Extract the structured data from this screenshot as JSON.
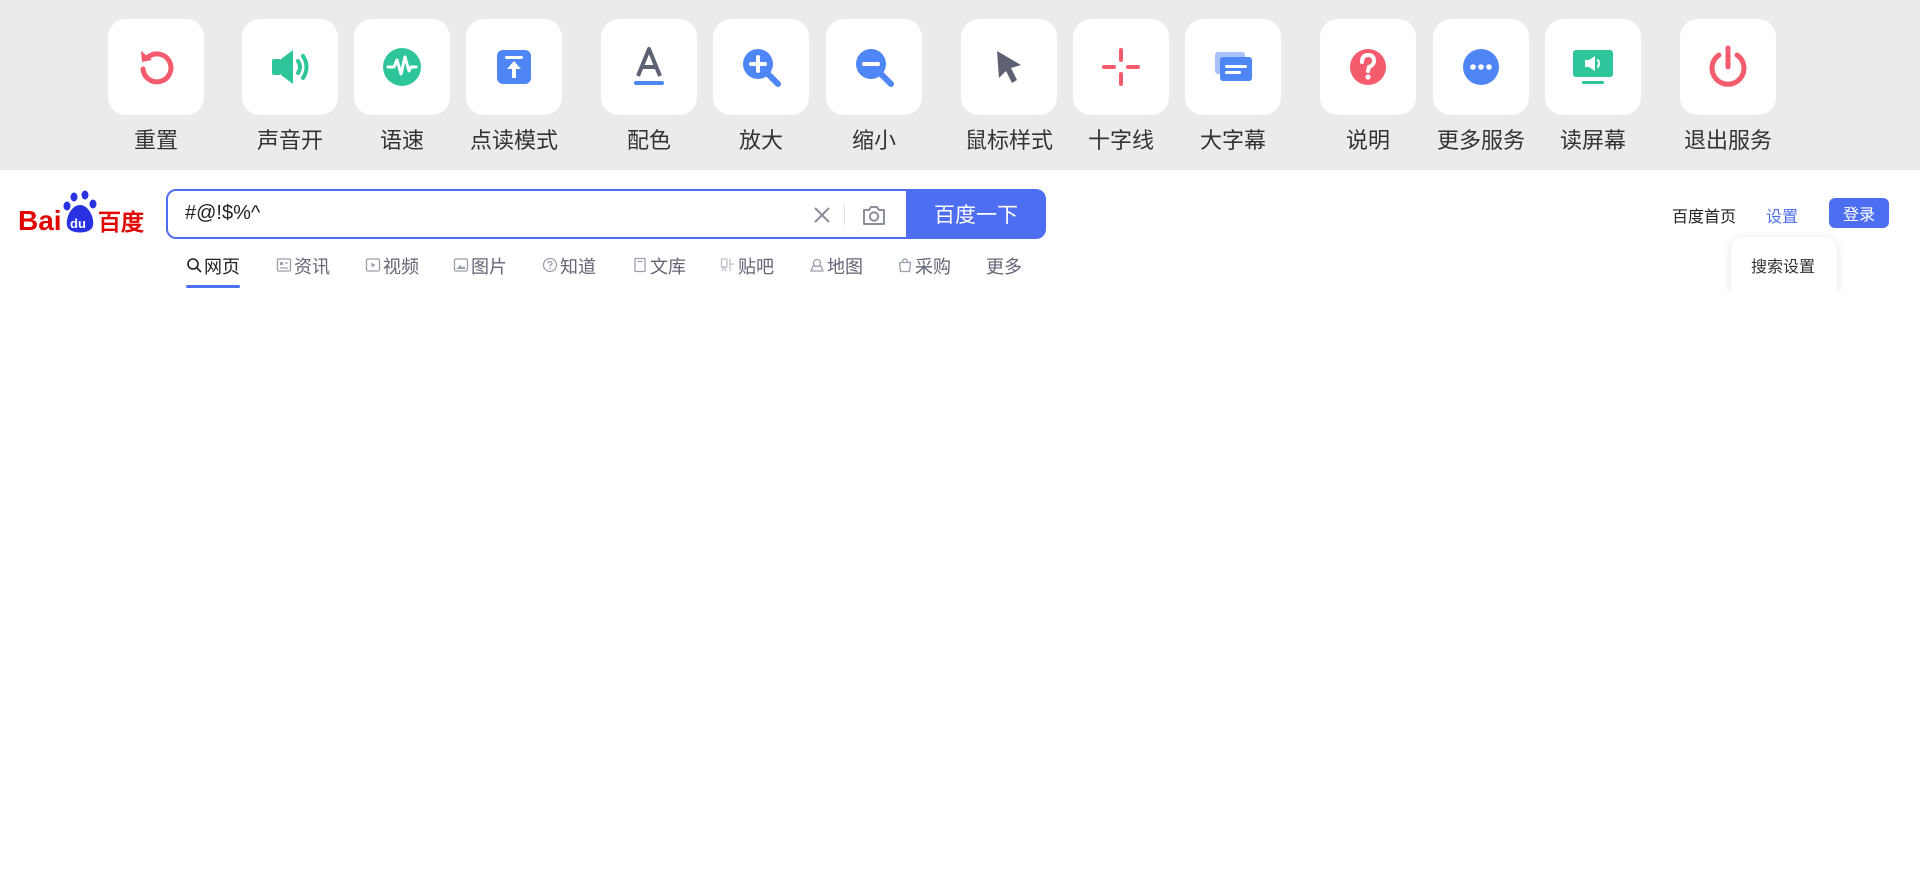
{
  "accessibility_toolbar": {
    "tools": [
      {
        "label": "重置",
        "icon": "reset-icon",
        "color": "#f45b6c"
      },
      {
        "label": "声音开",
        "icon": "speaker-on-icon",
        "color": "#2ec59b"
      },
      {
        "label": "语速",
        "icon": "speech-rate-icon",
        "color": "#2ec59b"
      },
      {
        "label": "点读模式",
        "icon": "point-read-icon",
        "color": "#4e86f5"
      },
      {
        "label": "配色",
        "icon": "color-scheme-icon",
        "color": "#4e86f5"
      },
      {
        "label": "放大",
        "icon": "zoom-in-icon",
        "color": "#4e86f5"
      },
      {
        "label": "缩小",
        "icon": "zoom-out-icon",
        "color": "#4e86f5"
      },
      {
        "label": "鼠标样式",
        "icon": "cursor-icon",
        "color": "#5e6173"
      },
      {
        "label": "十字线",
        "icon": "crosshair-icon",
        "color": "#f45b6c"
      },
      {
        "label": "大字幕",
        "icon": "large-caption-icon",
        "color": "#4e86f5"
      },
      {
        "label": "说明",
        "icon": "help-icon",
        "color": "#f45b6c"
      },
      {
        "label": "更多服务",
        "icon": "more-icon",
        "color": "#4e86f5"
      },
      {
        "label": "读屏幕",
        "icon": "screen-reader-icon",
        "color": "#2ec59b"
      },
      {
        "label": "退出服务",
        "icon": "power-icon",
        "color": "#f45b6c"
      }
    ]
  },
  "header": {
    "logo_text": "Bai百度",
    "search": {
      "value": "#@!$%^",
      "button_label": "百度一下"
    },
    "home_link": "百度首页",
    "settings_link": "设置",
    "login_label": "登录",
    "settings_menu": {
      "item": "搜索设置"
    }
  },
  "tabs": [
    {
      "label": "网页",
      "icon": "search-icon",
      "active": true
    },
    {
      "label": "资讯",
      "icon": "news-icon"
    },
    {
      "label": "视频",
      "icon": "video-icon"
    },
    {
      "label": "图片",
      "icon": "image-icon"
    },
    {
      "label": "知道",
      "icon": "question-icon"
    },
    {
      "label": "文库",
      "icon": "doc-icon"
    },
    {
      "label": "贴吧",
      "icon": "tieba-icon"
    },
    {
      "label": "地图",
      "icon": "map-icon"
    },
    {
      "label": "采购",
      "icon": "bag-icon"
    },
    {
      "label": "更多"
    }
  ],
  "colors": {
    "brand_blue": "#4e6ef2",
    "brand_red": "#e10602",
    "toolbar_bg": "#ebebeb"
  }
}
